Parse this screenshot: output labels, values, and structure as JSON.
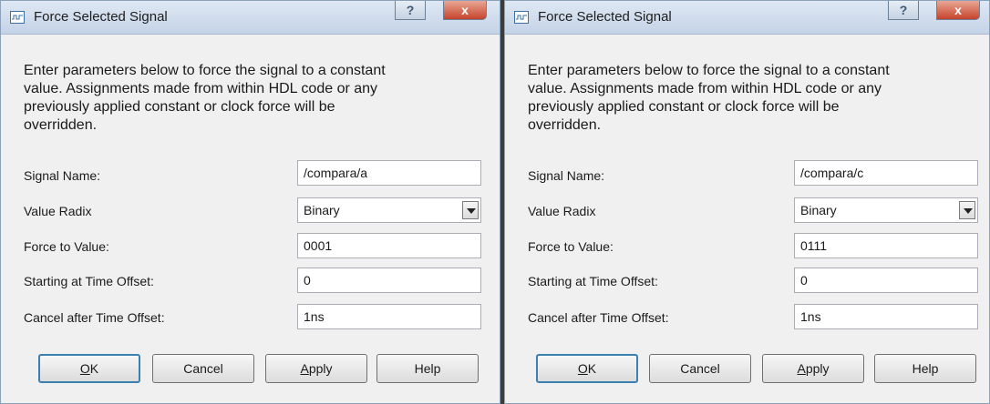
{
  "dialogs": [
    {
      "title": "Force Selected Signal",
      "description": [
        "Enter parameters below to force the signal to a constant",
        "value. Assignments made from within HDL code or any",
        "previously applied constant or clock force will be",
        "overridden."
      ],
      "fields": {
        "signal_name_label": "Signal Name:",
        "signal_name_value": "/compara/a",
        "value_radix_label": "Value Radix",
        "value_radix_value": "Binary",
        "force_value_label": "Force to Value:",
        "force_value_value": "0001",
        "start_offset_label": "Starting at Time Offset:",
        "start_offset_value": "0",
        "cancel_offset_label": "Cancel after Time Offset:",
        "cancel_offset_value": "1ns"
      },
      "buttons": {
        "ok_first": "O",
        "ok_rest": "K",
        "cancel": "Cancel",
        "apply_first": "A",
        "apply_rest": "pply",
        "help": "Help"
      },
      "titlebar": {
        "help_glyph": "?",
        "close_glyph": "x"
      }
    },
    {
      "title": "Force Selected Signal",
      "description": [
        "Enter parameters below to force the signal to a constant",
        "value. Assignments made from within HDL code or any",
        "previously applied constant or clock force will be",
        "overridden."
      ],
      "fields": {
        "signal_name_label": "Signal Name:",
        "signal_name_value": "/compara/c",
        "value_radix_label": "Value Radix",
        "value_radix_value": "Binary",
        "force_value_label": "Force to Value:",
        "force_value_value": "0111",
        "start_offset_label": "Starting at Time Offset:",
        "start_offset_value": "0",
        "cancel_offset_label": "Cancel after Time Offset:",
        "cancel_offset_value": "1ns"
      },
      "buttons": {
        "ok_first": "O",
        "ok_rest": "K",
        "cancel": "Cancel",
        "apply_first": "A",
        "apply_rest": "pply",
        "help": "Help"
      },
      "titlebar": {
        "help_glyph": "?",
        "close_glyph": "x"
      }
    }
  ]
}
